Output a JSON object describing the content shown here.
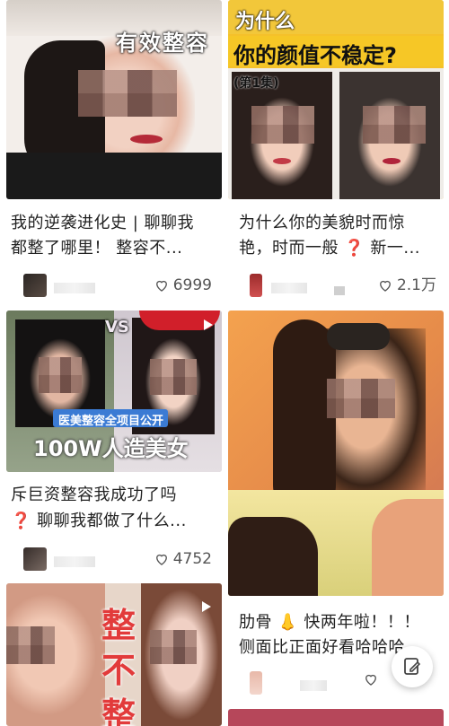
{
  "cards": [
    {
      "overlay": "有效整容",
      "title_line1": "我的逆袭进化史 | 聊聊我",
      "title_line2": "都整了哪里！ 整容不...",
      "likes": "6999"
    },
    {
      "overlay_top": "为什么",
      "overlay_main": "你的颜值不稳定?",
      "overlay_sub": "(第1集)",
      "title_line1": "为什么你的美貌时而惊",
      "title_line2": "艳，时而一般 ❓ 新一...",
      "likes": "2.1万"
    },
    {
      "overlay_vs": "VS",
      "overlay_banner": "医美整容全项目公开",
      "overlay_main": "100W人造美女",
      "title_line1": "斥巨资整容我成功了吗",
      "title_line2": "❓ 聊聊我都做了什么...",
      "likes": "4752"
    },
    {
      "title_line1": "肋骨 👃 快两年啦！！！",
      "title_line2": "侧面比正面好看哈哈哈",
      "likes": ""
    },
    {
      "overlay_chars": [
        "整",
        "不",
        "整"
      ]
    }
  ],
  "icons": {
    "heart": "heart-outline-icon",
    "edit": "edit-note-icon",
    "play": "play-icon"
  },
  "colors": {
    "accent_red": "#e8242e",
    "text_dark": "#222222",
    "meta_gray": "#555555"
  }
}
